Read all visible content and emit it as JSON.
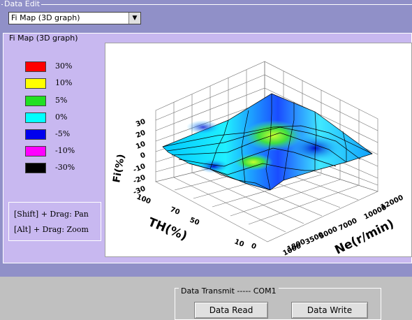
{
  "data_edit": {
    "label": "Data Edit"
  },
  "selector": {
    "selected": "Fi Map (3D graph)",
    "arrow_icon": "chevron-down-icon"
  },
  "panel": {
    "label": "Fi Map (3D graph)"
  },
  "legend": [
    {
      "color": "#ff0000",
      "label": "30%"
    },
    {
      "color": "#ffff00",
      "label": "10%"
    },
    {
      "color": "#22e022",
      "label": "5%"
    },
    {
      "color": "#00ffff",
      "label": "0%"
    },
    {
      "color": "#0000ee",
      "label": "-5%"
    },
    {
      "color": "#ff00ff",
      "label": "-10%"
    },
    {
      "color": "#000000",
      "label": "-30%"
    }
  ],
  "help": {
    "pan": "[Shift] + Drag:   Pan",
    "zoom": "[Alt] + Drag:    Zoom"
  },
  "graph": {
    "z_axis_label": "Fi(%)",
    "x_axis_label": "TH(%)",
    "y_axis_label": "Ne(r/min)",
    "z_ticks": [
      "30",
      "20",
      "10",
      "0",
      "-10",
      "-20",
      "-30"
    ],
    "th_ticks": [
      "100",
      "70",
      "50",
      "10",
      "0"
    ],
    "ne_ticks": [
      "12000",
      "10000",
      "7000",
      "5000",
      "3500",
      "1800",
      "1000"
    ]
  },
  "transmit": {
    "label": "Data Transmit ----- COM1",
    "read_label": "Data Read",
    "write_label": "Data Write"
  }
}
